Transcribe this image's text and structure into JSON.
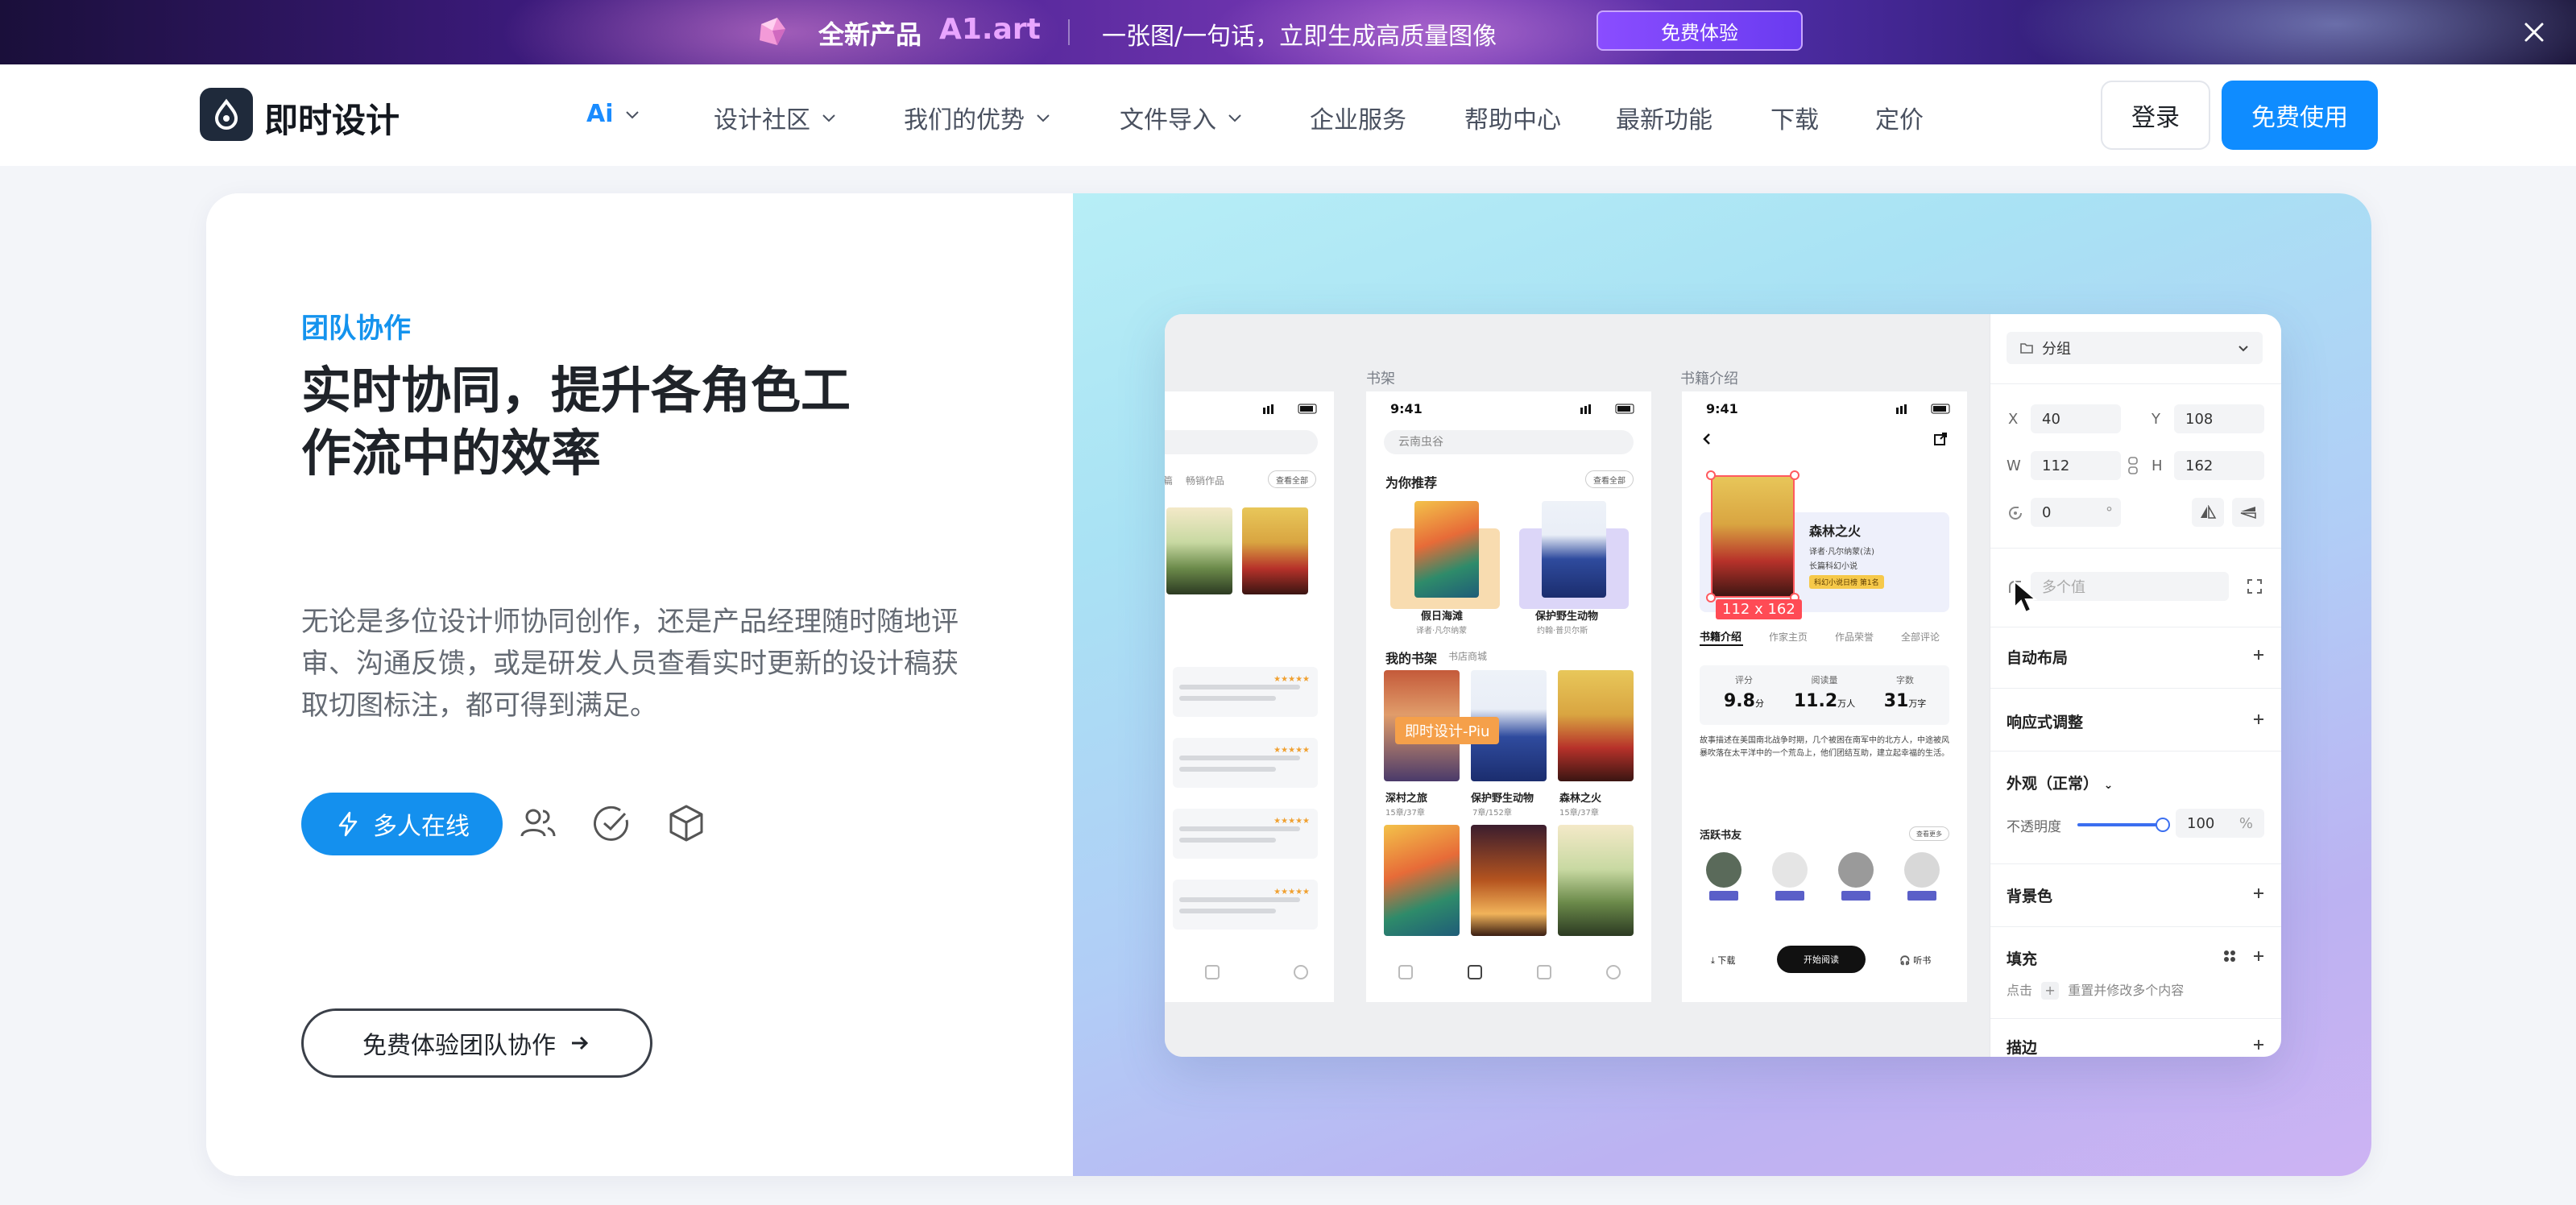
{
  "banner": {
    "label": "全新产品",
    "product": "A1.art",
    "tagline": "一张图/一句话，立即生成高质量图像",
    "cta": "免费体验"
  },
  "nav": {
    "brand": "即时设计",
    "items": [
      "Ai",
      "设计社区",
      "我们的优势",
      "文件导入",
      "企业服务",
      "帮助中心",
      "最新功能",
      "下载",
      "定价"
    ],
    "login": "登录",
    "free": "免费使用"
  },
  "feature": {
    "eyebrow": "团队协作",
    "headline": "实时协同，提升各角色工作流中的效率",
    "description": "无论是多位设计师协同创作，还是产品经理随时随地评审、沟通反馈，或是研发人员查看实时更新的设计稿获取切图标注，都可得到满足。",
    "online_btn": "多人在线",
    "cta": "免费体验团队协作"
  },
  "editor": {
    "frames": [
      "书架",
      "书籍介绍"
    ],
    "phone_time": "9:41",
    "shelf": {
      "search": "云南虫谷",
      "recommend": "为你推荐",
      "see_all": "查看全部",
      "rec_books": [
        {
          "title": "假日海滩",
          "sub": "译者·凡尔纳蒙"
        },
        {
          "title": "保护野生动物",
          "sub": "约翰·普贝尔斯"
        }
      ],
      "my_shelf": "我的书架",
      "store": "书店商城",
      "shelf_books": [
        {
          "title": "深村之旅",
          "sub": "15章/37章"
        },
        {
          "title": "保护野生动物",
          "sub": "7章/152章"
        },
        {
          "title": "森林之火",
          "sub": "15章/37章"
        }
      ],
      "cursor_user": "即时设计-Piu"
    },
    "left_phone": {
      "tab": "畅销作品",
      "tab2": "篇",
      "see_all": "查看全部"
    },
    "detail": {
      "title": "森林之火",
      "author": "译者·凡尔纳蒙(法)",
      "genre": "长篇科幻小说",
      "badge": "科幻小说日榜 第1名",
      "tabs": [
        "书籍介绍",
        "作家主页",
        "作品荣誉",
        "全部评论"
      ],
      "stats": [
        {
          "k": "评分",
          "v": "9.8",
          "u": "分"
        },
        {
          "k": "阅读量",
          "v": "11.2",
          "u": "万人"
        },
        {
          "k": "字数",
          "v": "31",
          "u": "万字"
        }
      ],
      "blurb": "故事描述在美国南北战争时期，几个被困在南军中的北方人，中途被风暴吹落在太平洋中的一个荒岛上，他们团结互助，建立起幸福的生活。",
      "readers": "活跃书友",
      "readers_more": "查看更多",
      "download": "下载",
      "start": "开始阅读",
      "listen": "听书",
      "size": "112 x 162"
    },
    "panel": {
      "group": "分组",
      "x": "40",
      "y": "108",
      "w": "112",
      "h": "162",
      "rotation": "0",
      "deg": "°",
      "radius_placeholder": "多个值",
      "auto_layout": "自动布局",
      "responsive": "响应式调整",
      "appearance": "外观（正常）",
      "opacity_label": "不透明度",
      "opacity": "100",
      "percent": "%",
      "opacity_value": 1.0,
      "bg_color": "背景色",
      "fill": "填充",
      "fill_hint_pre": "点击",
      "fill_hint_post": "重置并修改多个内容",
      "stroke": "描边",
      "label_x": "X",
      "label_y": "Y",
      "label_w": "W",
      "label_h": "H"
    }
  },
  "colors": {
    "accent": "#0f8cff",
    "eyebrow": "#1493ee",
    "selection": "#ff5a5f",
    "collab_cursor": "#f5a04a",
    "promo_name": "#e9a5ff"
  },
  "icons": {
    "banner": [
      "gem-icon",
      "close-icon"
    ],
    "feature": [
      "lightning-icon",
      "users-icon",
      "check-circle-icon",
      "cube-icon",
      "arrow-right-icon"
    ]
  }
}
